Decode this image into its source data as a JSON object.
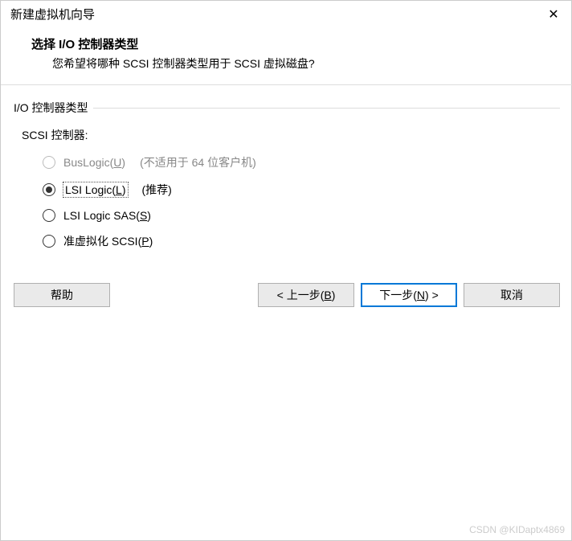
{
  "titlebar": {
    "title": "新建虚拟机向导"
  },
  "header": {
    "title": "选择 I/O 控制器类型",
    "subtitle": "您希望将哪种 SCSI 控制器类型用于 SCSI 虚拟磁盘?"
  },
  "fieldset": {
    "legend": "I/O 控制器类型",
    "controller_label": "SCSI 控制器:"
  },
  "radios": {
    "buslogic": {
      "label_prefix": "BusLogic(",
      "hotkey": "U",
      "label_suffix": ")",
      "note": "(不适用于 64 位客户机)"
    },
    "lsi": {
      "label_prefix": "LSI Logic(",
      "hotkey": "L",
      "label_suffix": ")",
      "note": "(推荐)"
    },
    "lsisas": {
      "label_prefix": "LSI Logic SAS(",
      "hotkey": "S",
      "label_suffix": ")"
    },
    "pvscsi": {
      "label_prefix": "准虚拟化 SCSI(",
      "hotkey": "P",
      "label_suffix": ")"
    }
  },
  "footer": {
    "help": "帮助",
    "back_prefix": "< 上一步(",
    "back_hotkey": "B",
    "back_suffix": ")",
    "next_prefix": "下一步(",
    "next_hotkey": "N",
    "next_suffix": ") >",
    "cancel": "取消"
  },
  "watermark": "CSDN @KIDaptx4869"
}
